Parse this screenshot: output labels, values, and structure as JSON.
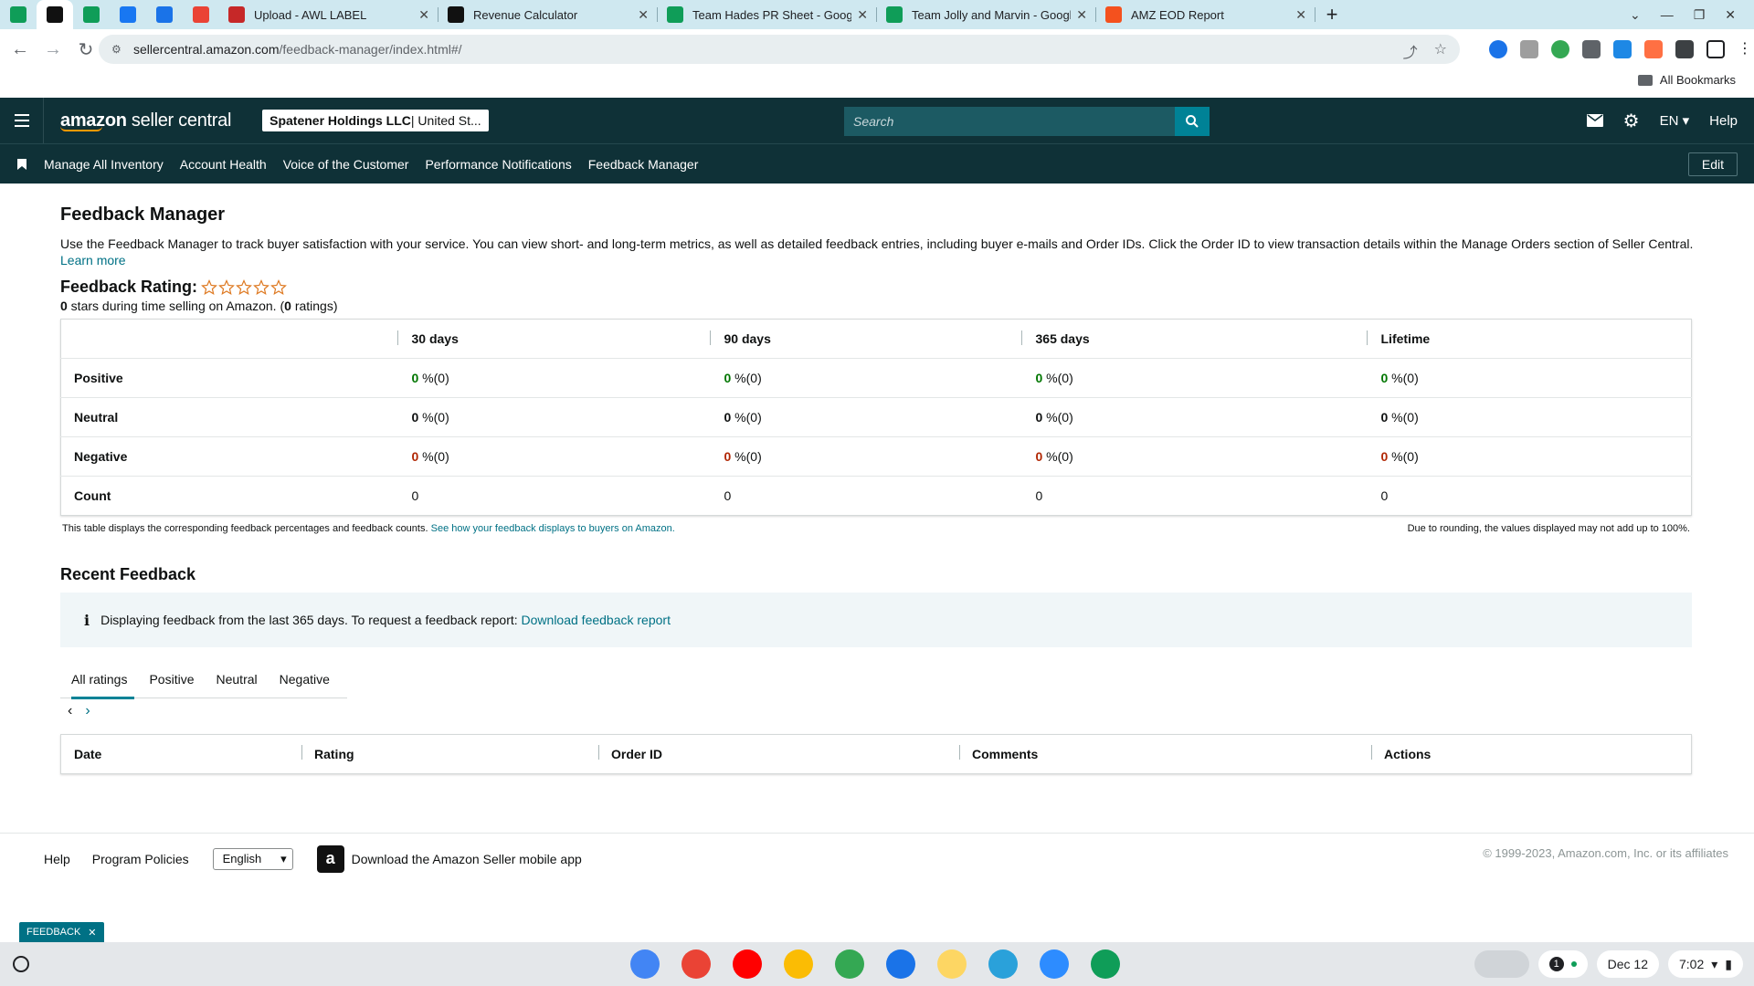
{
  "browser": {
    "pinned_tabs": [
      {
        "icon": "sheets-icon",
        "color": "#0f9d58"
      },
      {
        "icon": "amazon-icon",
        "color": "#111111"
      },
      {
        "icon": "extension-icon",
        "color": "#0f9d58"
      },
      {
        "icon": "facebook-icon",
        "color": "#1877f2"
      },
      {
        "icon": "settings-icon",
        "color": "#1a73e8"
      },
      {
        "icon": "gmail-icon",
        "color": "#ea4335"
      }
    ],
    "tabs": [
      {
        "title": "Upload - AWL LABEL",
        "icon": "awl-icon",
        "color": "#c62828"
      },
      {
        "title": "Revenue Calculator",
        "icon": "amazon-icon",
        "color": "#111111"
      },
      {
        "title": "Team Hades PR Sheet - Google",
        "icon": "sheets-icon",
        "color": "#0f9d58"
      },
      {
        "title": "Team Jolly and Marvin - Google",
        "icon": "sheets-icon",
        "color": "#0f9d58"
      },
      {
        "title": "AMZ EOD Report",
        "icon": "report-icon",
        "color": "#f4511e"
      }
    ],
    "url_host": "sellercentral.amazon.com",
    "url_path": "/feedback-manager/index.html#/",
    "all_bookmarks": "All Bookmarks"
  },
  "header": {
    "logo_main": "amazon",
    "logo_sub": " seller central",
    "account_bold": "Spatener Holdings LLC",
    "account_rest": " | United St...",
    "search_placeholder": "Search",
    "lang": "EN",
    "help": "Help"
  },
  "nav": {
    "items": [
      "Manage All Inventory",
      "Account Health",
      "Voice of the Customer",
      "Performance Notifications",
      "Feedback Manager"
    ],
    "edit": "Edit"
  },
  "page": {
    "title": "Feedback Manager",
    "description": "Use the Feedback Manager to track buyer satisfaction with your service. You can view short- and long-term metrics, as well as detailed feedback entries, including buyer e-mails and Order IDs. Click the Order ID to view transaction details within the Manage Orders section of Seller Central.",
    "learn_more": "Learn more",
    "rating_label": "Feedback Rating:",
    "stars_filled": 0,
    "stars_total": 5,
    "rating_stars_value": "0",
    "rating_sub_mid": " stars during time selling on Amazon. (",
    "rating_count": "0",
    "rating_sub_end": " ratings)"
  },
  "feedback_table": {
    "headers": [
      "",
      "30 days",
      "90 days",
      "365 days",
      "Lifetime"
    ],
    "rows": [
      {
        "label": "Positive",
        "cells": [
          [
            "0",
            " %(0)"
          ],
          [
            "0",
            " %(0)"
          ],
          [
            "0",
            " %(0)"
          ],
          [
            "0",
            " %(0)"
          ]
        ],
        "tone": "green"
      },
      {
        "label": "Neutral",
        "cells": [
          [
            "0",
            " %(0)"
          ],
          [
            "0",
            " %(0)"
          ],
          [
            "0",
            " %(0)"
          ],
          [
            "0",
            " %(0)"
          ]
        ],
        "tone": "plain"
      },
      {
        "label": "Negative",
        "cells": [
          [
            "0",
            " %(0)"
          ],
          [
            "0",
            " %(0)"
          ],
          [
            "0",
            " %(0)"
          ],
          [
            "0",
            " %(0)"
          ]
        ],
        "tone": "red"
      },
      {
        "label": "Count",
        "cells": [
          [
            "",
            "0"
          ],
          [
            "",
            "0"
          ],
          [
            "",
            "0"
          ],
          [
            "",
            "0"
          ]
        ],
        "tone": "count"
      }
    ],
    "note_left": "This table displays the corresponding feedback percentages and feedback counts.",
    "note_link": "See how your feedback displays to buyers on Amazon.",
    "note_right": "Due to rounding, the values displayed may not add up to 100%."
  },
  "recent": {
    "title": "Recent Feedback",
    "info_text": "Displaying feedback from the last 365 days. To request a feedback report:",
    "info_link": "Download feedback report",
    "tabs": [
      "All ratings",
      "Positive",
      "Neutral",
      "Negative"
    ],
    "active_tab": 0,
    "columns": [
      "Date",
      "Rating",
      "Order ID",
      "Comments",
      "Actions"
    ]
  },
  "footer": {
    "help": "Help",
    "policies": "Program Policies",
    "language": "English",
    "app_text": "Download the Amazon Seller mobile app",
    "copyright": "© 1999-2023, Amazon.com, Inc. or its affiliates"
  },
  "badge": {
    "label": "FEEDBACK"
  },
  "shelf": {
    "apps": [
      {
        "name": "chrome-icon",
        "color": "#4285f4"
      },
      {
        "name": "gmail-icon",
        "color": "#ea4335"
      },
      {
        "name": "youtube-icon",
        "color": "#ff0000"
      },
      {
        "name": "drive-icon",
        "color": "#fbbc04"
      },
      {
        "name": "play-store-icon",
        "color": "#34a853"
      },
      {
        "name": "files-icon",
        "color": "#1a73e8"
      },
      {
        "name": "notes-icon",
        "color": "#fdd663"
      },
      {
        "name": "telegram-icon",
        "color": "#2aa1da"
      },
      {
        "name": "zoom-icon",
        "color": "#2d8cff"
      },
      {
        "name": "sheets-icon",
        "color": "#0f9d58"
      }
    ],
    "notification_count": "1",
    "date": "Dec 12",
    "time": "7:02"
  }
}
